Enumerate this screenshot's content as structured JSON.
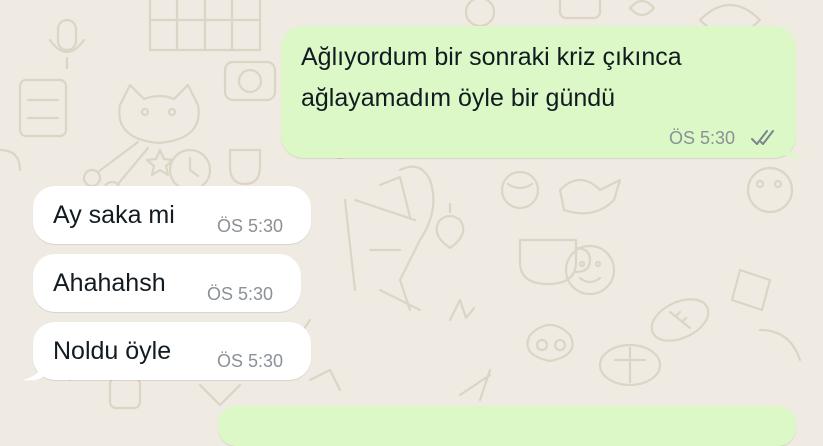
{
  "chat": {
    "outgoing": [
      {
        "line1": "Ağlıyordum bir sonraki kriz çıkınca",
        "line2": "ağlayamadım öyle bir gündü",
        "time": "ÖS 5:30",
        "status_icon": "double-check-read-icon"
      }
    ],
    "incoming": [
      {
        "text": "Ay saka mi",
        "time": "ÖS 5:30"
      },
      {
        "text": "Ahahahsh",
        "time": "ÖS 5:30"
      },
      {
        "text": "Noldu öyle",
        "time": "ÖS 5:30"
      }
    ]
  },
  "colors": {
    "wallpaper": "#efeae2",
    "outgoing_bubble": "#dcf8c6",
    "incoming_bubble": "#ffffff",
    "timestamp": "#8a9197",
    "message_text": "#111b21"
  }
}
